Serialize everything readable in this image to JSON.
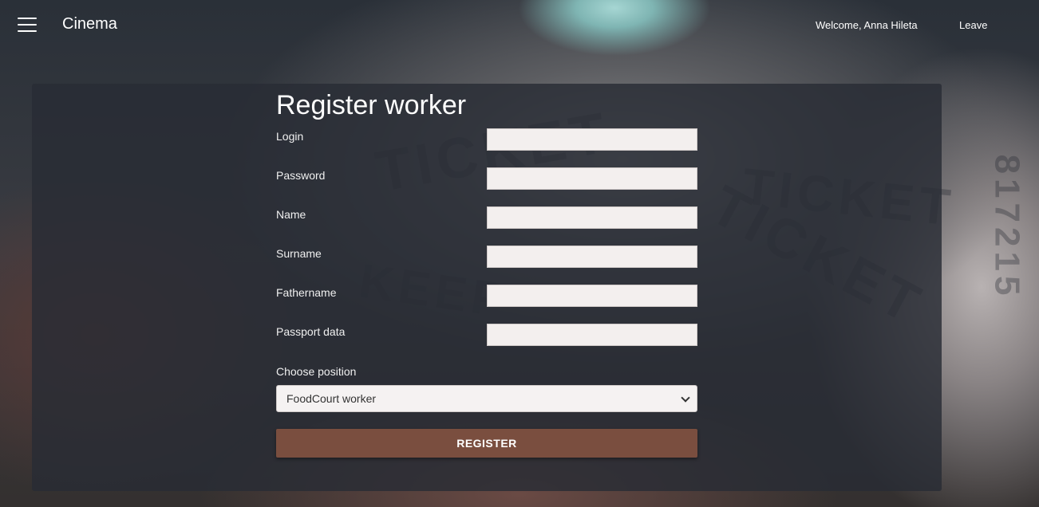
{
  "header": {
    "brand": "Cinema",
    "welcome": "Welcome, Anna Hileta",
    "leave_label": "Leave"
  },
  "form": {
    "title": "Register worker",
    "fields": [
      {
        "label": "Login",
        "value": ""
      },
      {
        "label": "Password",
        "value": ""
      },
      {
        "label": "Name",
        "value": ""
      },
      {
        "label": "Surname",
        "value": ""
      },
      {
        "label": "Fathername",
        "value": ""
      },
      {
        "label": "Passport data",
        "value": ""
      }
    ],
    "position_label": "Choose position",
    "position_selected": "FoodCourt worker",
    "submit_label": "REGISTER"
  },
  "colors": {
    "panel": "#282c34",
    "button": "#7a4e3f",
    "input_bg": "#f3efee"
  },
  "icons": {
    "menu": "hamburger-menu-icon",
    "select": "chevron-down-icon"
  }
}
